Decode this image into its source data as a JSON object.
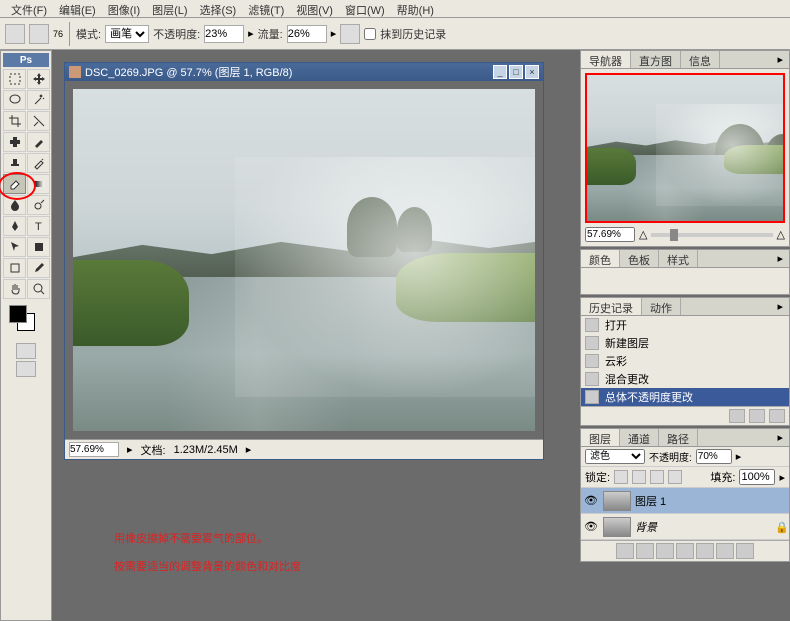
{
  "menu": [
    "文件(F)",
    "编辑(E)",
    "图像(I)",
    "图层(L)",
    "选择(S)",
    "滤镜(T)",
    "视图(V)",
    "窗口(W)",
    "帮助(H)"
  ],
  "opt": {
    "brush_num": "76",
    "mode_lbl": "模式:",
    "mode_val": "画笔",
    "opacity_lbl": "不透明度:",
    "opacity_val": "23%",
    "flow_lbl": "流量:",
    "flow_val": "26%",
    "erase_hist": "抹到历史记录"
  },
  "doc": {
    "title": "DSC_0269.JPG @ 57.7% (图层 1, RGB/8)",
    "zoom": "57.69%",
    "info_lbl": "文档:",
    "info_val": "1.23M/2.45M"
  },
  "nav": {
    "tabs": [
      "导航器",
      "直方图",
      "信息"
    ],
    "zoom": "57.69%"
  },
  "color": {
    "tabs": [
      "颜色",
      "色板",
      "样式"
    ]
  },
  "hist": {
    "tabs": [
      "历史记录",
      "动作"
    ],
    "items": [
      "打开",
      "新建图层",
      "云彩",
      "混合更改",
      "总体不透明度更改"
    ]
  },
  "lyr": {
    "tabs": [
      "图层",
      "通道",
      "路径"
    ],
    "blend": "滤色",
    "op_lbl": "不透明度:",
    "op_val": "70%",
    "lock_lbl": "锁定:",
    "fill_lbl": "填充:",
    "fill_val": "100%",
    "layers": [
      {
        "name": "图层 1"
      },
      {
        "name": "背景"
      }
    ]
  },
  "annot": {
    "l1": "用橡皮擦掉不需要雾气的部位。",
    "l2": "按需要适当的调整背景的颜色和对比度"
  },
  "ps": "Ps"
}
